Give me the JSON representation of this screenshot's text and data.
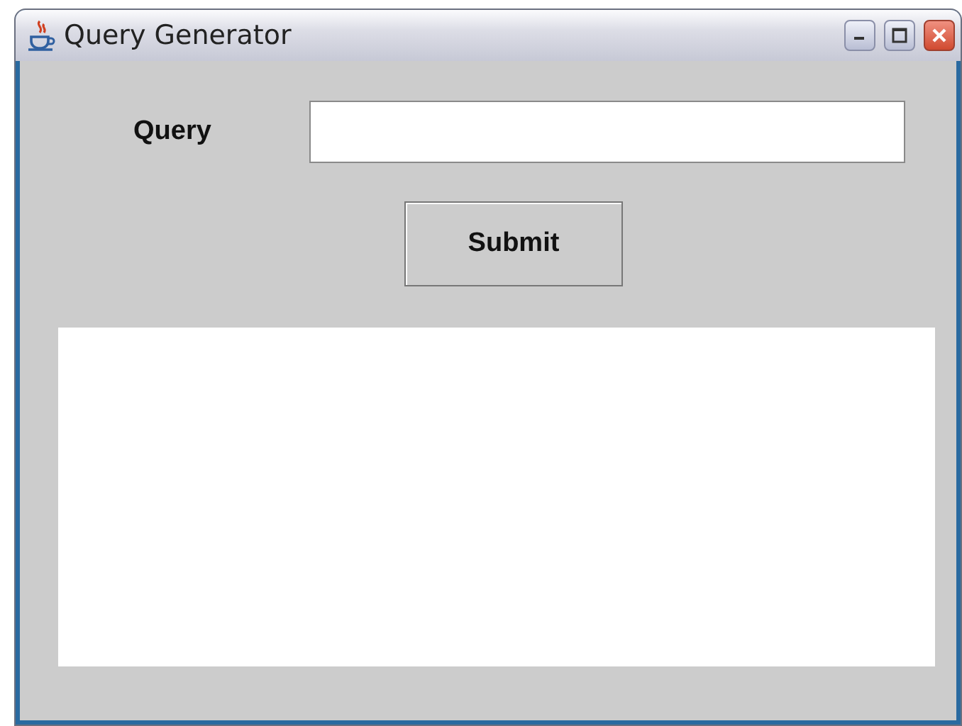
{
  "window": {
    "title": "Query Generator"
  },
  "form": {
    "label": "Query"
  },
  "buttons": [
    "Submit"
  ]
}
